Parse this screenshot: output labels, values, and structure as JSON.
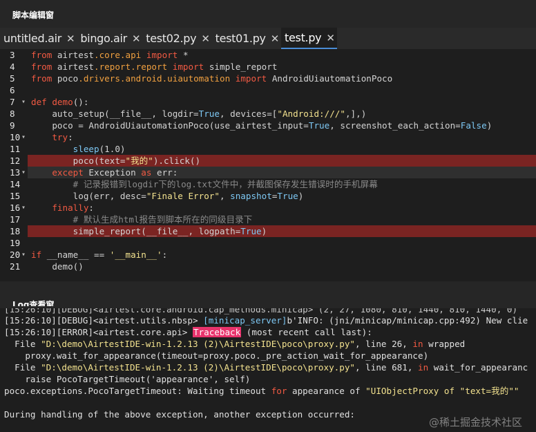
{
  "editor": {
    "title": "脚本编辑窗",
    "tabs": [
      {
        "label": "untitled.air",
        "active": false
      },
      {
        "label": "bingo.air",
        "active": false
      },
      {
        "label": "test02.py",
        "active": false
      },
      {
        "label": "test01.py",
        "active": false
      },
      {
        "label": "test.py",
        "active": true
      }
    ],
    "close_glyph": "✕",
    "lines": [
      {
        "n": "3",
        "tokens": [
          [
            "kw",
            "from"
          ],
          [
            "t",
            " airtest"
          ],
          [
            "mod",
            ".core.api"
          ],
          [
            "t",
            " "
          ],
          [
            "kw",
            "import"
          ],
          [
            "t",
            " *"
          ]
        ]
      },
      {
        "n": "4",
        "tokens": [
          [
            "kw",
            "from"
          ],
          [
            "t",
            " airtest"
          ],
          [
            "mod",
            ".report.report"
          ],
          [
            "t",
            " "
          ],
          [
            "kw",
            "import"
          ],
          [
            "t",
            " simple_report"
          ]
        ]
      },
      {
        "n": "5",
        "tokens": [
          [
            "kw",
            "from"
          ],
          [
            "t",
            " poco"
          ],
          [
            "mod",
            ".drivers.android.uiautomation"
          ],
          [
            "t",
            " "
          ],
          [
            "kw",
            "import"
          ],
          [
            "t",
            " AndroidUiautomationPoco"
          ]
        ]
      },
      {
        "n": "6",
        "tokens": []
      },
      {
        "n": "7",
        "fold": true,
        "tokens": [
          [
            "kw",
            "def"
          ],
          [
            "t",
            " "
          ],
          [
            "kw",
            "demo"
          ],
          [
            "t",
            "():"
          ]
        ]
      },
      {
        "n": "8",
        "tokens": [
          [
            "t",
            "    auto_setup(__file__, logdir="
          ],
          [
            "const",
            "True"
          ],
          [
            "t",
            ", devices=["
          ],
          [
            "str",
            "\"Android:///\""
          ],
          [
            "t",
            ",],)"
          ]
        ]
      },
      {
        "n": "9",
        "tokens": [
          [
            "t",
            "    poco = AndroidUiautomationPoco(use_airtest_input="
          ],
          [
            "const",
            "True"
          ],
          [
            "t",
            ", screenshot_each_action="
          ],
          [
            "const",
            "False"
          ],
          [
            "t",
            ")"
          ]
        ]
      },
      {
        "n": "10",
        "fold": true,
        "tokens": [
          [
            "t",
            "    "
          ],
          [
            "kw",
            "try"
          ],
          [
            "t",
            ":"
          ]
        ]
      },
      {
        "n": "11",
        "tokens": [
          [
            "t",
            "        "
          ],
          [
            "bi",
            "sleep"
          ],
          [
            "t",
            "(1.0)"
          ]
        ]
      },
      {
        "n": "12",
        "hl": "error",
        "tokens": [
          [
            "t",
            "        poco(text="
          ],
          [
            "str",
            "\"我的\""
          ],
          [
            "t",
            ").click()"
          ]
        ]
      },
      {
        "n": "13",
        "fold": true,
        "hl": "current",
        "tokens": [
          [
            "t",
            "    "
          ],
          [
            "kw",
            "except"
          ],
          [
            "t",
            " Exception "
          ],
          [
            "kw",
            "as"
          ],
          [
            "t",
            " err:"
          ]
        ]
      },
      {
        "n": "14",
        "tokens": [
          [
            "t",
            "        "
          ],
          [
            "cmt",
            "# 记录报错到logdir下的log.txt文件中，并截图保存发生错误时的手机屏幕"
          ]
        ]
      },
      {
        "n": "15",
        "tokens": [
          [
            "t",
            "        log(err, desc="
          ],
          [
            "str",
            "\"Finale Error\""
          ],
          [
            "t",
            ", "
          ],
          [
            "bi",
            "snapshot"
          ],
          [
            "t",
            "="
          ],
          [
            "const",
            "True"
          ],
          [
            "t",
            ")"
          ]
        ]
      },
      {
        "n": "16",
        "fold": true,
        "tokens": [
          [
            "t",
            "    "
          ],
          [
            "kw",
            "finally"
          ],
          [
            "t",
            ":"
          ]
        ]
      },
      {
        "n": "17",
        "tokens": [
          [
            "t",
            "        "
          ],
          [
            "cmt",
            "# 默认生成html报告到脚本所在的同级目录下"
          ]
        ]
      },
      {
        "n": "18",
        "hl": "error",
        "tokens": [
          [
            "t",
            "        simple_report(__file__, logpath="
          ],
          [
            "const",
            "True"
          ],
          [
            "t",
            ")"
          ]
        ]
      },
      {
        "n": "19",
        "tokens": []
      },
      {
        "n": "20",
        "fold": true,
        "tokens": [
          [
            "kw",
            "if"
          ],
          [
            "t",
            " __name__ == "
          ],
          [
            "str",
            "'__main__'"
          ],
          [
            "t",
            ":"
          ]
        ]
      },
      {
        "n": "21",
        "tokens": [
          [
            "t",
            "    demo()"
          ]
        ]
      }
    ]
  },
  "log": {
    "title": "Log查看窗",
    "lines": [
      {
        "partial": true,
        "tokens": [
          [
            "t",
            "[15:26:10][DEBUG]<airtest.core.android.cap_methods.minicap> (2, 27, 1080, 810, 1440, 810, 1440, 0)"
          ]
        ]
      },
      {
        "tokens": [
          [
            "t",
            "[15:26:10][DEBUG]<airtest.utils.nbsp> "
          ],
          [
            "blue",
            "[minicap_server]"
          ],
          [
            "t",
            "b'INFO: (jni/minicap/minicap.cpp:492) New clie"
          ]
        ]
      },
      {
        "tokens": [
          [
            "t",
            "[15:26:10][ERROR]<airtest.core.api> "
          ],
          [
            "badge",
            "Traceback"
          ],
          [
            "t",
            " (most recent call last):"
          ]
        ]
      },
      {
        "tokens": [
          [
            "t",
            "  File "
          ],
          [
            "lstr",
            "\"D:\\demo\\AirtestIDE-win-1.2.13 (2)\\AirtestIDE\\poco\\proxy.py\""
          ],
          [
            "t",
            ", line 26, "
          ],
          [
            "lkw",
            "in"
          ],
          [
            "t",
            " wrapped"
          ]
        ]
      },
      {
        "tokens": [
          [
            "t",
            "    proxy.wait_for_appearance(timeout=proxy.poco._pre_action_wait_for_appearance)"
          ]
        ]
      },
      {
        "tokens": [
          [
            "t",
            "  File "
          ],
          [
            "lstr",
            "\"D:\\demo\\AirtestIDE-win-1.2.13 (2)\\AirtestIDE\\poco\\proxy.py\""
          ],
          [
            "t",
            ", line 681, "
          ],
          [
            "lkw",
            "in"
          ],
          [
            "t",
            " wait_for_appearanc"
          ]
        ]
      },
      {
        "tokens": [
          [
            "t",
            "    raise PocoTargetTimeout('appearance', self)"
          ]
        ]
      },
      {
        "tokens": [
          [
            "t",
            "poco.exceptions.PocoTargetTimeout: Waiting timeout "
          ],
          [
            "lkw",
            "for"
          ],
          [
            "t",
            " appearance of "
          ],
          [
            "lstr",
            "\"UIObjectProxy of \"text=我的\"\""
          ]
        ]
      },
      {
        "tokens": [
          [
            "t",
            ""
          ]
        ]
      },
      {
        "tokens": [
          [
            "t",
            "During handling of the above exception, another exception occurred:"
          ]
        ]
      }
    ]
  },
  "watermark": "@稀土掘金技术社区",
  "colors": {
    "background": "#1e1e1e",
    "keyword": "#f25a43",
    "module": "#f0a040",
    "string": "#f3e28f",
    "builtin": "#7ec8f4",
    "comment": "#8a8a8a",
    "error_highlight": "#7a2422",
    "traceback_badge": "#e8336c",
    "active_tab_underline": "#4a8cd6"
  }
}
